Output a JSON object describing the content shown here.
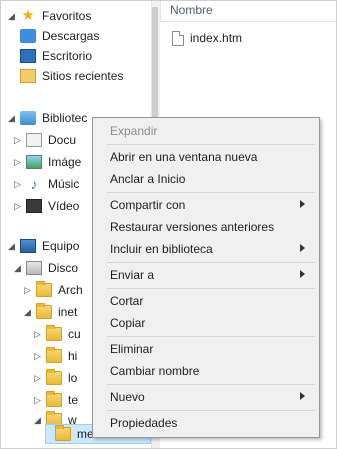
{
  "tree": {
    "favorites": "Favoritos",
    "downloads": "Descargas",
    "desktop": "Escritorio",
    "recent": "Sitios recientes",
    "libraries": "Bibliotec",
    "documents": "Docu",
    "images": "Imáge",
    "music": "Músic",
    "videos": "Vídeo",
    "computer": "Equipo",
    "disk": "Disco",
    "folder_arch": "Arch",
    "folder_inet": "inet",
    "folder_cu": "cu",
    "folder_hi": "hi",
    "folder_lo": "lo",
    "folder_te": "te",
    "folder_w": "w",
    "folder_selected": "mezones"
  },
  "list": {
    "column_name": "Nombre",
    "file_name": "index.htm"
  },
  "context_menu": {
    "expand": "Expandir",
    "open_new_window": "Abrir en una ventana nueva",
    "pin_start": "Anclar a Inicio",
    "share_with": "Compartir con",
    "restore_versions": "Restaurar versiones anteriores",
    "include_library": "Incluir en biblioteca",
    "send_to": "Enviar a",
    "cut": "Cortar",
    "copy": "Copiar",
    "delete": "Eliminar",
    "rename": "Cambiar nombre",
    "new": "Nuevo",
    "properties": "Propiedades"
  }
}
